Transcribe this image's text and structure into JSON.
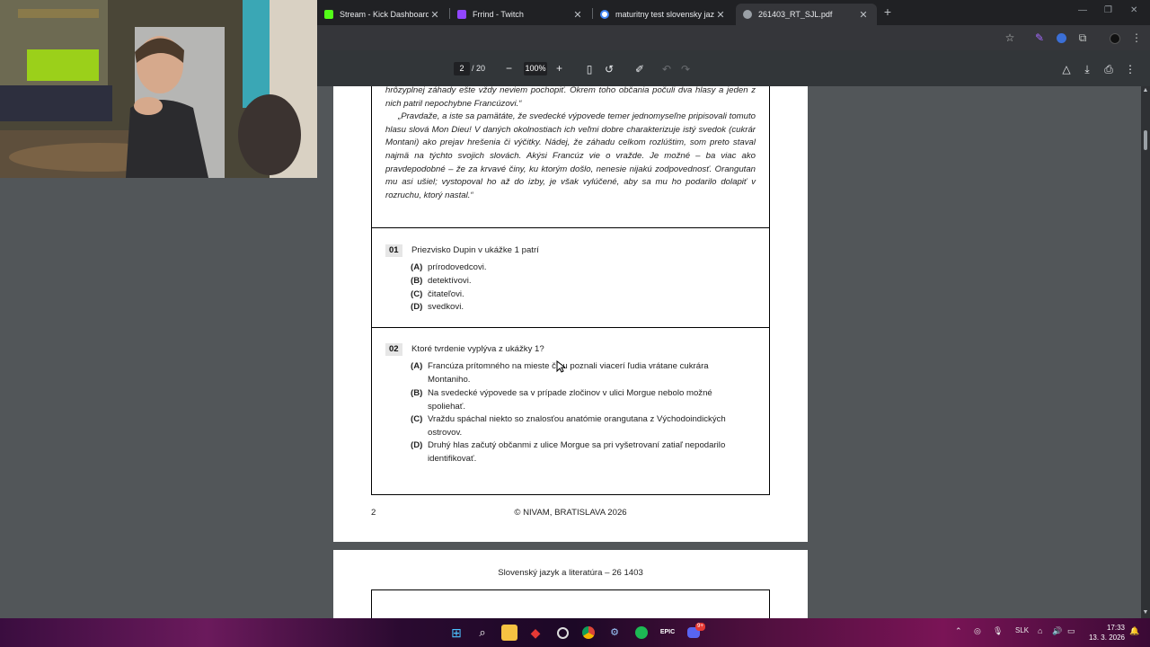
{
  "browser": {
    "tabs": [
      {
        "title": "Stream - Kick Dashboard",
        "icon": "kick-icon"
      },
      {
        "title": "Frrind - Twitch",
        "icon": "twitch-icon"
      },
      {
        "title": "maturitny test slovensky jazyk",
        "icon": "google-icon"
      },
      {
        "title": "261403_RT_SJL.pdf",
        "icon": "pdf-globe-icon"
      }
    ],
    "close_glyph": "✕",
    "new_tab_glyph": "+"
  },
  "pdf": {
    "page_current": "2",
    "page_total": "/ 20",
    "zoom": "100%",
    "zoom_out_glyph": "−",
    "zoom_in_glyph": "+"
  },
  "document": {
    "passage_lines": [
      "hrôzyplnej záhady ešte vždy neviem pochopiť. Okrem toho občania počuli dva hlasy a jeden z nich patril nepochybne Francúzovi.“",
      "„Pravdaže, a iste sa pamätáte, že svedecké výpovede temer jednomyseľne pripisovali tomuto hlasu slová Mon Dieu! V daných okolnostiach ich veľmi dobre charakterizuje istý svedok (cukrár Montani) ako prejav hrešenia či výčitky. Nádej, že záhadu celkom rozlúštim, som preto staval najmä na týchto svojich slovách. Akýsi Francúz vie o vražde. Je možné – ba viac ako pravdepodobné – že za krvavé činy, ku ktorým došlo, nenesie nijakú zodpovednosť. Orangutan mu asi ušiel; vystopoval ho až do izby, je však vylúčené, aby sa mu ho podarilo dolapiť v rozruchu, ktorý nastal.“"
    ],
    "questions": [
      {
        "number": "01",
        "text": "Priezvisko Dupin v ukážke 1 patrí",
        "options": [
          {
            "label": "(A)",
            "text": "prírodovedcovi."
          },
          {
            "label": "(B)",
            "text": "detektívovi."
          },
          {
            "label": "(C)",
            "text": "čitateľovi."
          },
          {
            "label": "(D)",
            "text": "svedkovi."
          }
        ]
      },
      {
        "number": "02",
        "text": "Ktoré tvrdenie vyplýva z ukážky 1?",
        "options": [
          {
            "label": "(A)",
            "text": "Francúza prítomného na mieste činu poznali viacerí ľudia vrátane cukrára Montaniho."
          },
          {
            "label": "(B)",
            "text": "Na svedecké výpovede sa v prípade zločinov v ulici Morgue nebolo možné spoliehať."
          },
          {
            "label": "(C)",
            "text": "Vraždu spáchal niekto so znalosťou anatómie orangutana z Východoindických ostrovov."
          },
          {
            "label": "(D)",
            "text": "Druhý hlas začutý občanmi z ulice Morgue sa pri vyšetrovaní zatiaľ nepodarilo identifikovať."
          }
        ]
      }
    ],
    "footer_page": "2",
    "footer_copyright": "© NIVAM, BRATISLAVA 2026",
    "next_page_header": "Slovenský jazyk a literatúra – 26 1403"
  },
  "taskbar": {
    "language": "SLK",
    "time": "17:33",
    "date": "13. 3. 2026",
    "discord_badge": "9+"
  },
  "colors": {
    "kick": "#53fc18",
    "twitch": "#9146ff",
    "pdf_bg": "#525659",
    "toolbar": "#35363a"
  }
}
